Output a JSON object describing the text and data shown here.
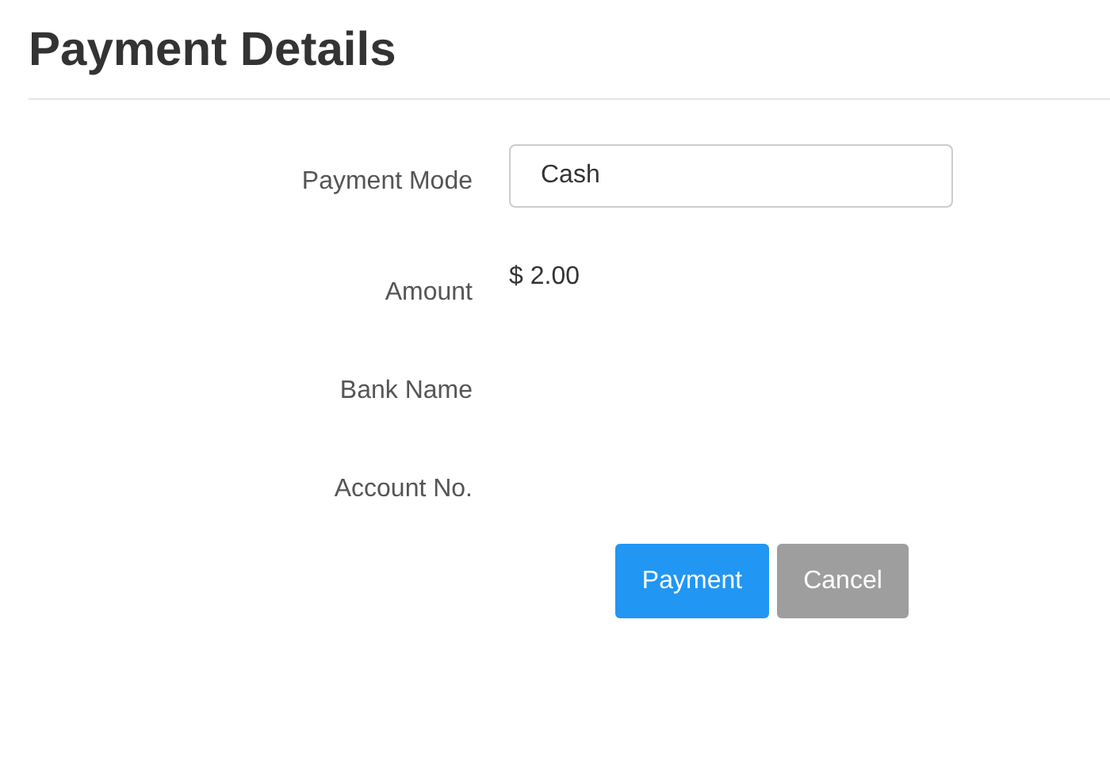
{
  "title": "Payment Details",
  "fields": [
    {
      "label": "Payment Mode",
      "kind": "input",
      "value": "Cash"
    },
    {
      "label": "Amount",
      "kind": "text",
      "value": "$ 2.00"
    },
    {
      "label": "Bank Name",
      "kind": "text"
    },
    {
      "label": "Account No.",
      "kind": "text"
    }
  ],
  "buttons": [
    {
      "label": "Payment",
      "kind": "primary"
    },
    {
      "label": "Cancel",
      "kind": "secondary"
    }
  ]
}
